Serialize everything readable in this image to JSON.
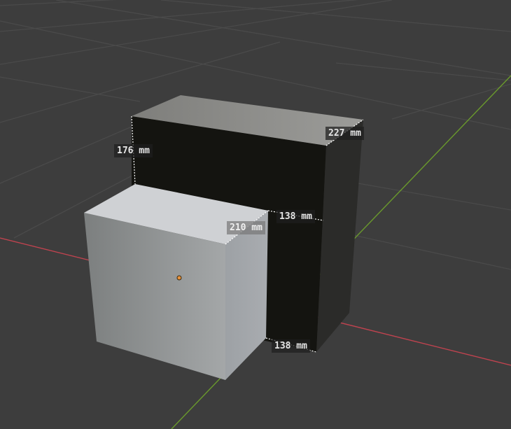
{
  "viewport": {
    "background_color": "#3d3d3d",
    "grid_color": "#484848",
    "x_axis_color": "#c0434f",
    "y_axis_color": "#6a9a2c",
    "origin_color": "#e8913a"
  },
  "objects": {
    "back_box": {
      "top_color": "#8f8f8c",
      "front_color": "#141410",
      "side_color": "#2b2b29"
    },
    "front_box": {
      "top_color": "#cfd1d4",
      "front_color": "#8e9090",
      "side_color": "#a6a9ac"
    }
  },
  "measurements": {
    "back_width": "227 mm",
    "back_height": "176 mm",
    "back_depth_top": "138 mm",
    "back_depth_bottom": "138 mm",
    "front_width": "210 mm"
  }
}
